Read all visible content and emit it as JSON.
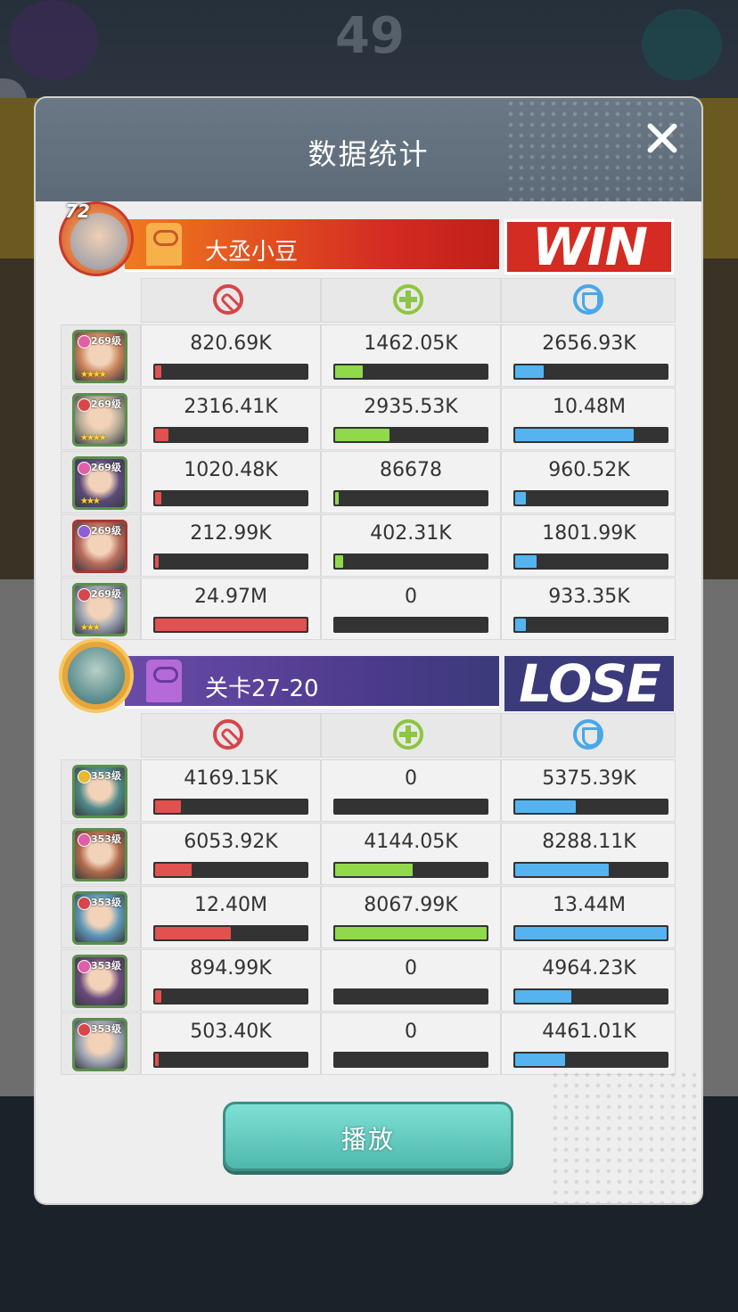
{
  "title": "数据统计",
  "background": {
    "score": "49"
  },
  "icons": {
    "close": "close-icon",
    "damage": "damage-icon",
    "heal": "heal-icon",
    "defense": "shield-icon"
  },
  "colors": {
    "damage": "#e0514f",
    "heal": "#8fd94a",
    "defense": "#55b4f0",
    "win": "#d42b22",
    "lose": "#3b3a7a"
  },
  "team1": {
    "leader_level": "72",
    "name": "大丞小豆",
    "result": "WIN",
    "heroes": [
      {
        "level": "269级",
        "stars": "★★★★",
        "damage": "820.69K",
        "damage_pct": 4,
        "heal": "1462.05K",
        "heal_pct": 18,
        "defense": "2656.93K",
        "defense_pct": 19,
        "frame": "#5a8f4a",
        "badge": "#e05fa8",
        "face": "#c9835a"
      },
      {
        "level": "269级",
        "stars": "★★★★",
        "damage": "2316.41K",
        "damage_pct": 9,
        "heal": "2935.53K",
        "heal_pct": 36,
        "defense": "10.48M",
        "defense_pct": 78,
        "frame": "#5a8f4a",
        "badge": "#d8454a",
        "face": "#b8ad98"
      },
      {
        "level": "269级",
        "stars": "★★★",
        "damage": "1020.48K",
        "damage_pct": 4,
        "heal": "86678",
        "heal_pct": 1,
        "defense": "960.52K",
        "defense_pct": 7,
        "frame": "#5a8f4a",
        "badge": "#e05fa8",
        "face": "#5a4a78"
      },
      {
        "level": "269级",
        "stars": "",
        "damage": "212.99K",
        "damage_pct": 1,
        "heal": "402.31K",
        "heal_pct": 5,
        "defense": "1801.99K",
        "defense_pct": 14,
        "frame": "#a8382f",
        "badge": "#8a5fd8",
        "face": "#b96d5c"
      },
      {
        "level": "269级",
        "stars": "★★★",
        "damage": "24.97M",
        "damage_pct": 100,
        "heal": "0",
        "heal_pct": 0,
        "defense": "933.35K",
        "defense_pct": 7,
        "frame": "#5a8f4a",
        "badge": "#d8454a",
        "face": "#9aa3b3"
      }
    ]
  },
  "team2": {
    "name": "关卡27-20",
    "result": "LOSE",
    "heroes": [
      {
        "level": "353级",
        "stars": "",
        "damage": "4169.15K",
        "damage_pct": 17,
        "heal": "0",
        "heal_pct": 0,
        "defense": "5375.39K",
        "defense_pct": 40,
        "frame": "#5a8f4a",
        "badge": "#e6b830",
        "face": "#4f8a88"
      },
      {
        "level": "353级",
        "stars": "",
        "damage": "6053.92K",
        "damage_pct": 24,
        "heal": "4144.05K",
        "heal_pct": 51,
        "defense": "8288.11K",
        "defense_pct": 62,
        "frame": "#5a8f4a",
        "badge": "#e05fa8",
        "face": "#b06a4a"
      },
      {
        "level": "353级",
        "stars": "",
        "damage": "12.40M",
        "damage_pct": 50,
        "heal": "8067.99K",
        "heal_pct": 100,
        "defense": "13.44M",
        "defense_pct": 100,
        "frame": "#5a8f4a",
        "badge": "#d8454a",
        "face": "#5f9ab8"
      },
      {
        "level": "353级",
        "stars": "",
        "damage": "894.99K",
        "damage_pct": 4,
        "heal": "0",
        "heal_pct": 0,
        "defense": "4964.23K",
        "defense_pct": 37,
        "frame": "#5a8f4a",
        "badge": "#e05fa8",
        "face": "#6a4a7a"
      },
      {
        "level": "353级",
        "stars": "",
        "damage": "503.40K",
        "damage_pct": 2,
        "heal": "0",
        "heal_pct": 0,
        "defense": "4461.01K",
        "defense_pct": 33,
        "frame": "#5a8f4a",
        "badge": "#d8454a",
        "face": "#a0a6b4"
      }
    ]
  },
  "play_button": "播放"
}
